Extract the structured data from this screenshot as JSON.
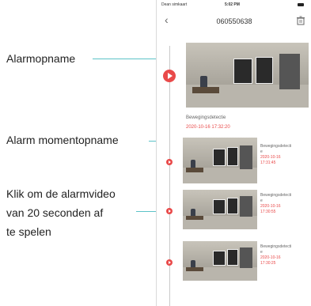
{
  "status": {
    "carrier": "Dean simkaart",
    "time": "5:02 PM"
  },
  "nav": {
    "title": "060550638"
  },
  "callouts": {
    "alarm_recording": "Alarmopname",
    "alarm_snapshot": "Alarm momentopname",
    "click_line1": "Klik om de alarmvideo",
    "click_line2": "van 20 seconden af",
    "click_line3": "te spelen"
  },
  "main_event": {
    "type": "Bewegingsdetectie",
    "timestamp": "2020-10-16  17:32:20"
  },
  "events": [
    {
      "type": "Bewegingsdetecti",
      "type_cont": "e",
      "date": "2020-10-16",
      "time": "17:31:45"
    },
    {
      "type": "Bewegingsdetecti",
      "type_cont": "e",
      "date": "2020-10-16",
      "time": "17:30:55"
    },
    {
      "type": "Bewegingsdetecti",
      "type_cont": "e",
      "date": "2020-10-16",
      "time": "17:30:25"
    }
  ],
  "colors": {
    "accent": "#e94a4a",
    "callout_line": "#5cc3c8"
  }
}
